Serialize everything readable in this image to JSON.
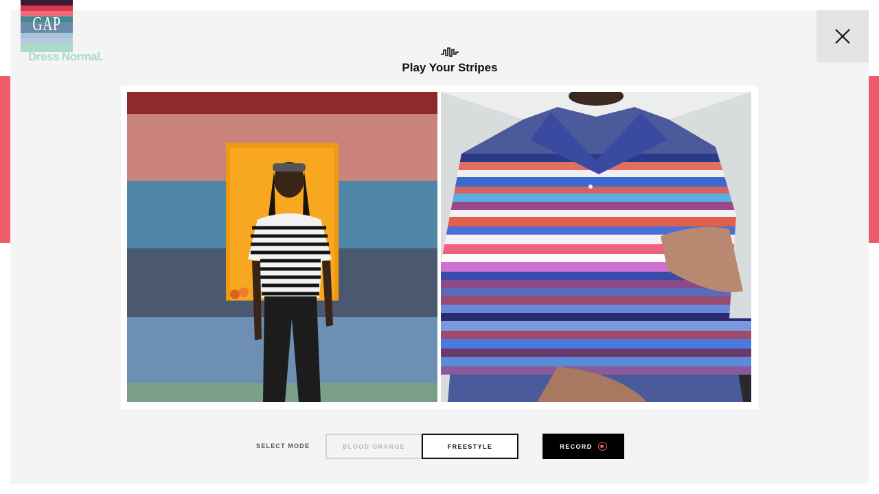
{
  "brand": {
    "logo_text": "GAP",
    "tagline": "Dress Normal.",
    "stripe_colors": [
      "#3b1a32",
      "#d8384a",
      "#ef6b7a",
      "#3e8b92",
      "#6a8ca8",
      "#a8c4dc",
      "#a8dcc6",
      "#b6c9e0"
    ]
  },
  "header": {
    "title": "Play Your Stripes",
    "title_icon": "waveform-icon"
  },
  "close_button": {
    "icon": "close-icon"
  },
  "previews": {
    "left": {
      "content": "person-standing-striped-wall-photo"
    },
    "right": {
      "content": "webcam-striped-polo-photo"
    }
  },
  "controls": {
    "mode_label": "SELECT MODE",
    "modes": [
      "BLOOD ORANGE",
      "FREESTYLE"
    ],
    "selected_mode": "FREESTYLE",
    "record_label": "RECORD",
    "record_icon": "record-icon"
  },
  "colors": {
    "accent": "#ef5b68",
    "tagline": "#a8dcc6",
    "background": "#f4f4f4"
  }
}
